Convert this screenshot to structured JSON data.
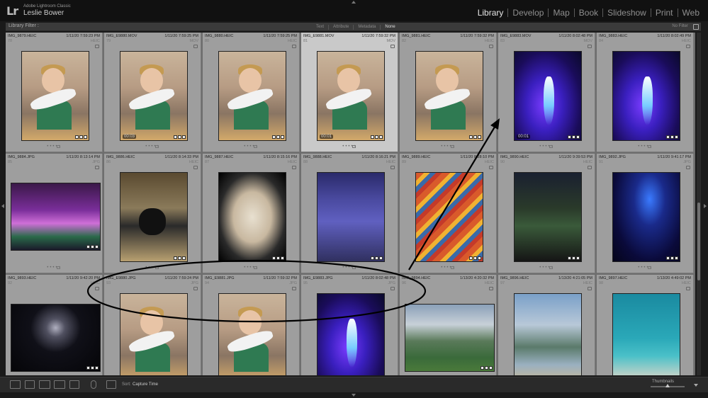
{
  "header": {
    "app_name": "Adobe Lightroom Classic",
    "logo": "Lr",
    "user_name": "Leslie Bower",
    "modules": [
      "Library",
      "Develop",
      "Map",
      "Book",
      "Slideshow",
      "Print",
      "Web"
    ],
    "active_module": "Library"
  },
  "filter_bar": {
    "title": "Library Filter :",
    "tabs": [
      "Text",
      "Attribute",
      "Metadata",
      "None"
    ],
    "active_tab": "None",
    "preset": "No Filter"
  },
  "grid": {
    "cells": [
      {
        "name": "IMG_9879.HEIC",
        "date": "1/11/20 7:59:23 PM",
        "index": "78",
        "ext": "HEIC",
        "scene": "baby",
        "duration": "",
        "selected": false
      },
      {
        "name": "IMG_E9880.MOV",
        "date": "1/11/20 7:59:25 PM",
        "index": "79",
        "ext": "MOV",
        "scene": "baby",
        "duration": "00:03",
        "selected": false
      },
      {
        "name": "IMG_9880.HEIC",
        "date": "1/11/20 7:59:25 PM",
        "index": "80",
        "ext": "HEIC",
        "scene": "baby",
        "duration": "",
        "selected": false
      },
      {
        "name": "IMG_E9881.MOV",
        "date": "1/11/20 7:59:32 PM",
        "index": "81",
        "ext": "MOV",
        "scene": "baby",
        "duration": "00:01",
        "selected": true
      },
      {
        "name": "IMG_9881.HEIC",
        "date": "1/11/20 7:59:32 PM",
        "index": "82",
        "ext": "HEIC",
        "scene": "baby",
        "duration": "",
        "selected": false
      },
      {
        "name": "IMG_E9883.MOV",
        "date": "1/11/20 8:02:48 PM",
        "index": "83",
        "ext": "MOV",
        "scene": "blue",
        "duration": "00:01",
        "selected": false
      },
      {
        "name": "IMG_9883.HEIC",
        "date": "1/11/20 8:02:49 PM",
        "index": "84",
        "ext": "HEIC",
        "scene": "blue",
        "duration": "",
        "selected": false
      },
      {
        "name": "IMG_9884.JPG",
        "date": "1/11/20 8:13:14 PM",
        "index": "85",
        "ext": "JPG",
        "scene": "car",
        "duration": "",
        "selected": false
      },
      {
        "name": "IMG_9886.HEIC",
        "date": "1/11/20 8:14:33 PM",
        "index": "86",
        "ext": "HEIC",
        "scene": "moto",
        "duration": "",
        "selected": false
      },
      {
        "name": "IMG_9887.HEIC",
        "date": "1/11/20 8:15:16 PM",
        "index": "87",
        "ext": "HEIC",
        "scene": "jacket",
        "duration": "",
        "selected": false
      },
      {
        "name": "IMG_9888.HEIC",
        "date": "1/11/20 8:16:21 PM",
        "index": "88",
        "ext": "HEIC",
        "scene": "piano",
        "duration": "",
        "selected": false
      },
      {
        "name": "IMG_9889.HEIC",
        "date": "1/11/20 8:28:10 PM",
        "index": "89",
        "ext": "HEIC",
        "scene": "poster",
        "duration": "",
        "selected": false
      },
      {
        "name": "IMG_9890.HEIC",
        "date": "1/11/20 9:39:53 PM",
        "index": "90",
        "ext": "HEIC",
        "scene": "dark",
        "duration": "",
        "selected": false
      },
      {
        "name": "IMG_9892.JPG",
        "date": "1/11/20 9:41:17 PM",
        "index": "91",
        "ext": "JPG",
        "scene": "concert",
        "duration": "",
        "selected": false
      },
      {
        "name": "IMG_9893.HEIC",
        "date": "1/11/20 9:42:20 PM",
        "index": "92",
        "ext": "HEIC",
        "scene": "screen",
        "duration": "",
        "selected": false
      },
      {
        "name": "IMG_E9880.JPG",
        "date": "1/11/20 7:59:24 PM",
        "index": "93",
        "ext": "JPG",
        "scene": "baby",
        "duration": "",
        "selected": false
      },
      {
        "name": "IMG_E9881.JPG",
        "date": "1/11/20 7:59:32 PM",
        "index": "94",
        "ext": "JPG",
        "scene": "baby",
        "duration": "",
        "selected": false
      },
      {
        "name": "IMG_E9883.JPG",
        "date": "1/11/20 8:02:48 PM",
        "index": "95",
        "ext": "JPG",
        "scene": "blue",
        "duration": "",
        "selected": false
      },
      {
        "name": "IMG_9894.HEIC",
        "date": "1/13/20 4:20:32 PM",
        "index": "96",
        "ext": "HEIC",
        "scene": "resort",
        "duration": "",
        "selected": false
      },
      {
        "name": "IMG_9896.HEIC",
        "date": "1/13/20 4:21:05 PM",
        "index": "97",
        "ext": "HEIC",
        "scene": "pool",
        "duration": "",
        "selected": false
      },
      {
        "name": "IMG_9897.HEIC",
        "date": "1/13/20 4:49:02 PM",
        "index": "98",
        "ext": "HEIC",
        "scene": "water",
        "duration": "",
        "selected": false
      }
    ]
  },
  "toolbar": {
    "sort_label": "Sort:",
    "sort_value": "Capture Time",
    "thumbnails_label": "Thumbnails",
    "thumbnail_size": 0.5
  },
  "colors": {
    "accent_annotation": "#000000",
    "selected_cell": "#c9c9c9",
    "cell": "#9e9e9e"
  }
}
